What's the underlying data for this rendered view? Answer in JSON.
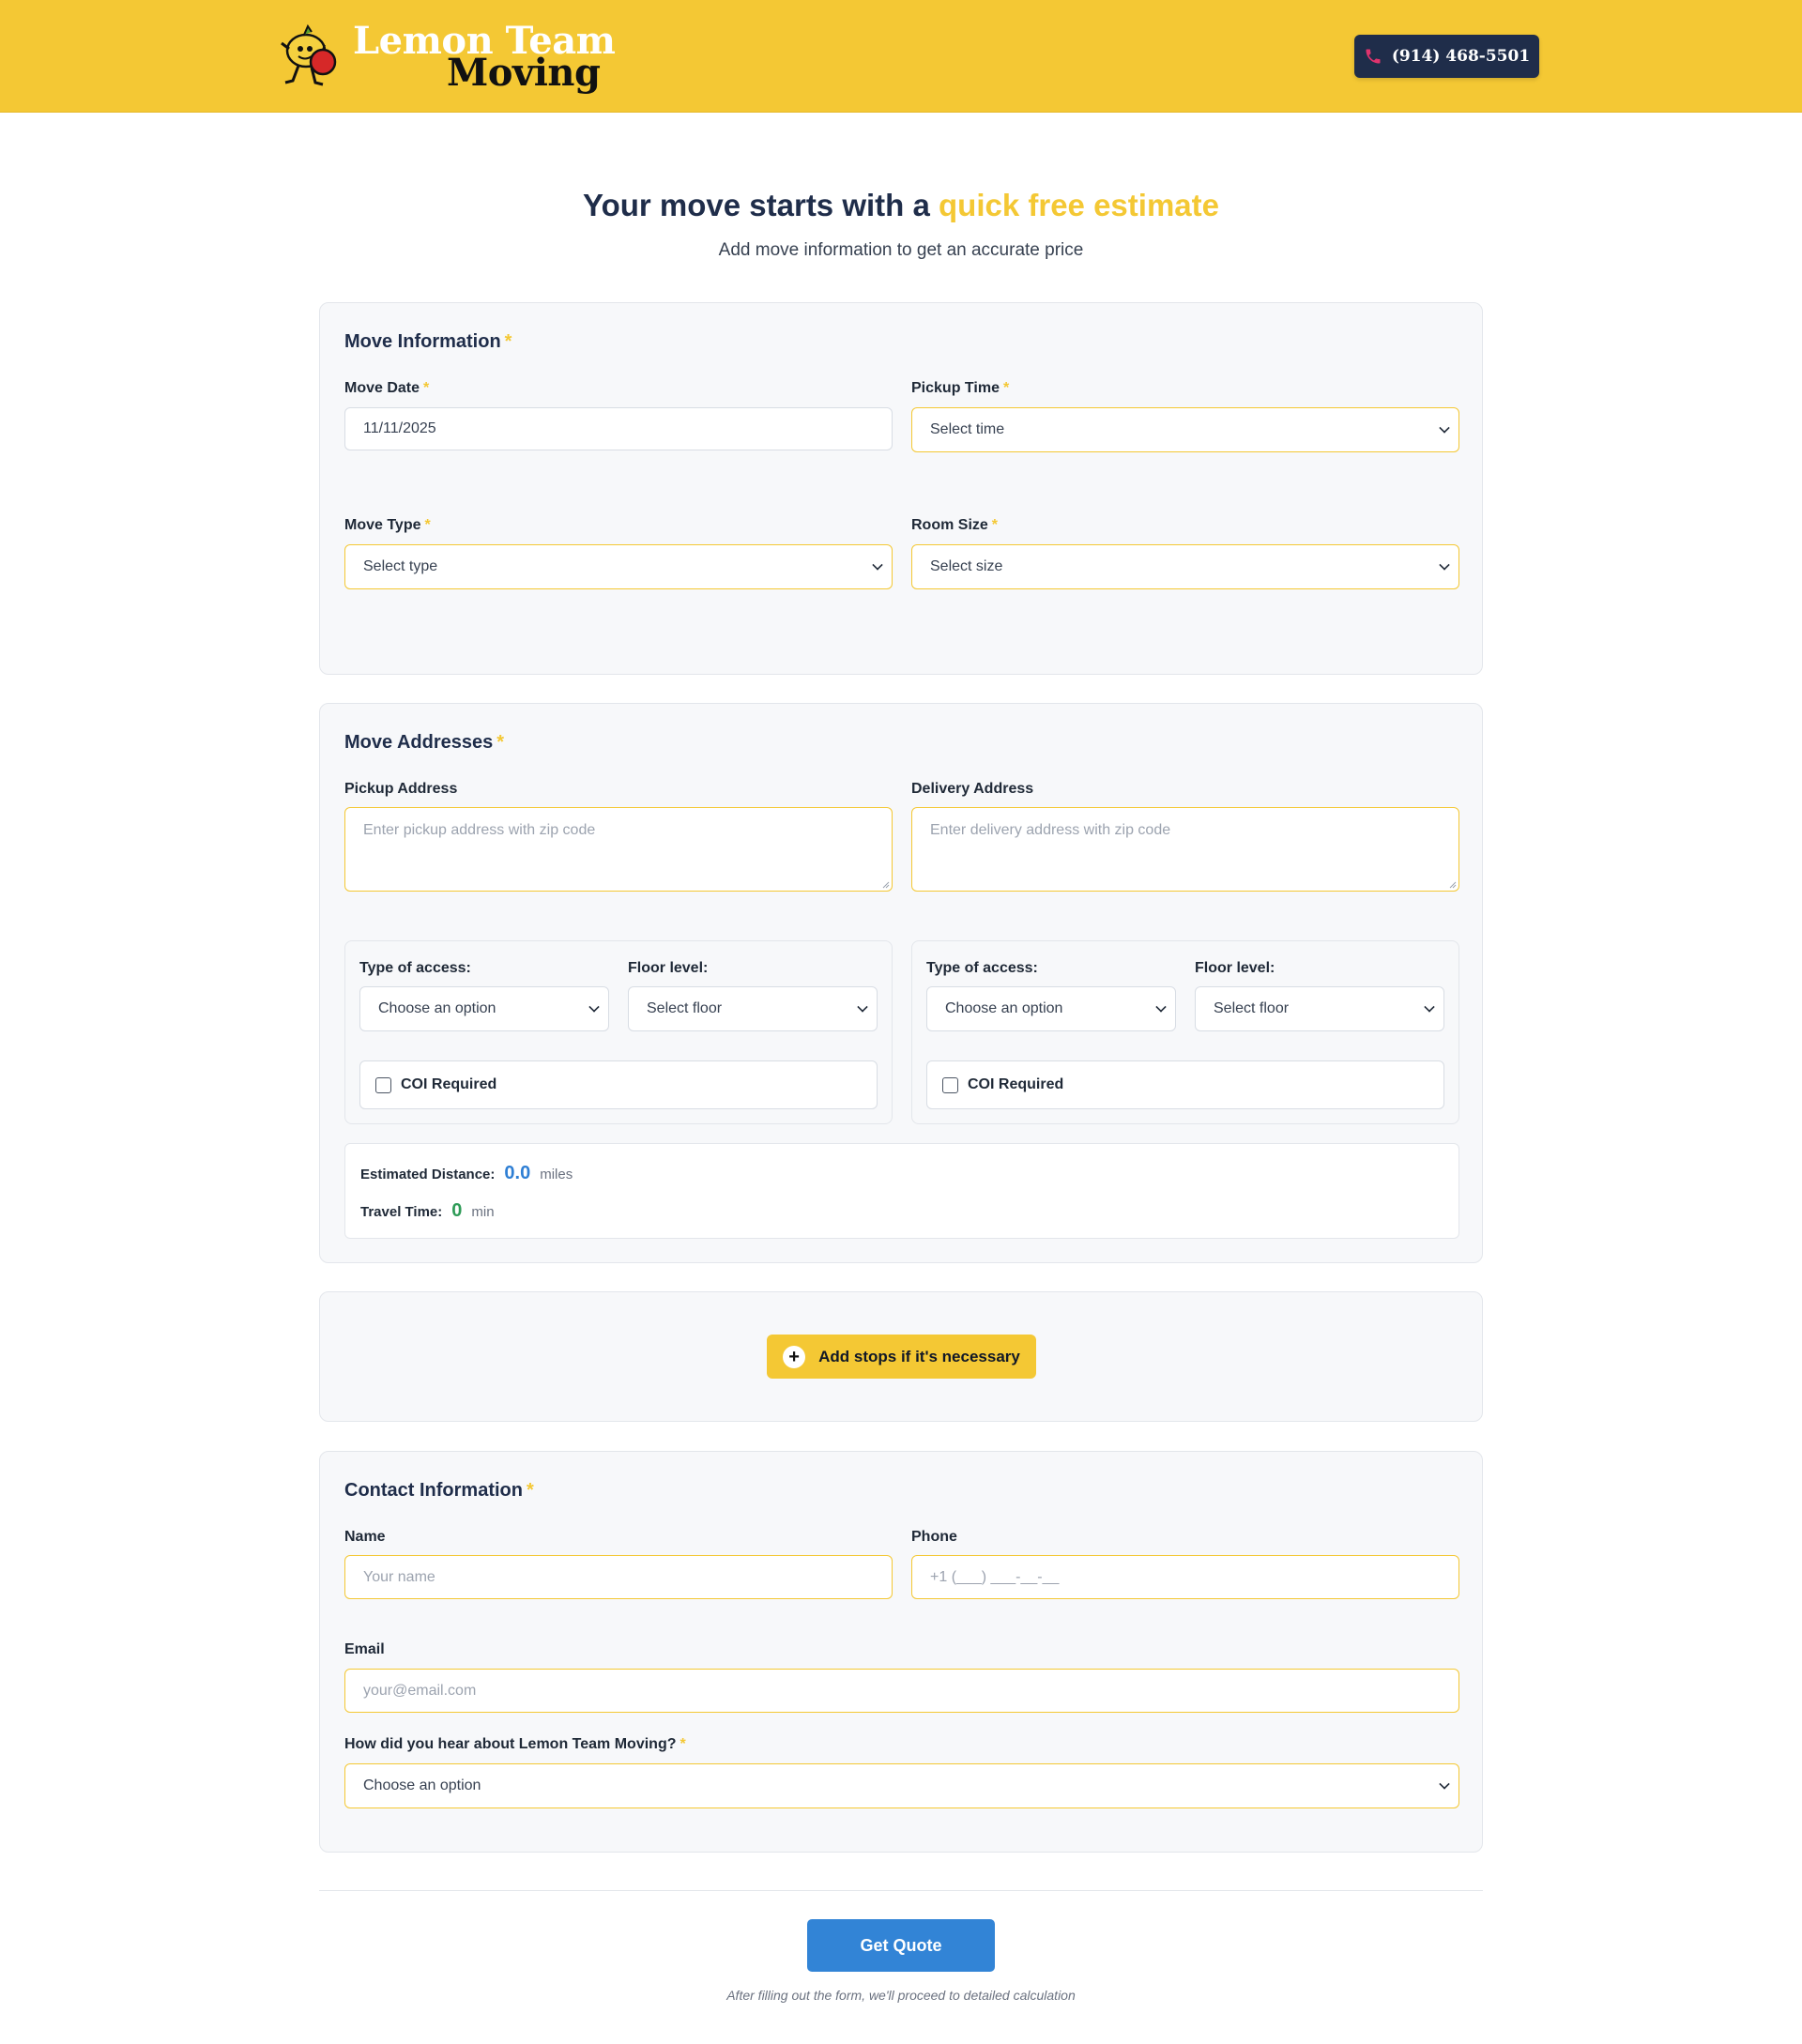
{
  "header": {
    "logo_line1": "Lemon Team",
    "logo_line2": "Moving",
    "phone": "(914) 468-5501",
    "colors": {
      "brand_yellow": "#f4c834",
      "navy": "#1f2d4a",
      "phone_icon": "#e0336d"
    }
  },
  "hero": {
    "title_prefix": "Your move starts with a",
    "title_accent": "quick free estimate",
    "subtitle": "Add move information to get an accurate price"
  },
  "move_info": {
    "title": "Move Information",
    "required_mark": "*",
    "move_date": {
      "label": "Move Date",
      "value": "11/11/2025"
    },
    "pickup_time": {
      "label": "Pickup Time",
      "selected": "Select time"
    },
    "move_type": {
      "label": "Move Type",
      "selected": "Select type"
    },
    "room_size": {
      "label": "Room Size",
      "selected": "Select size"
    }
  },
  "addresses": {
    "title": "Move Addresses",
    "pickup": {
      "label": "Pickup Address",
      "placeholder": "Enter pickup address with zip code"
    },
    "delivery": {
      "label": "Delivery Address",
      "placeholder": "Enter delivery address with zip code"
    },
    "pickup_details": {
      "access_label": "Type of access:",
      "access_selected": "Choose an option",
      "floor_label": "Floor level:",
      "floor_selected": "Select floor",
      "coi_label": "COI Required"
    },
    "delivery_details": {
      "access_label": "Type of access:",
      "access_selected": "Choose an option",
      "floor_label": "Floor level:",
      "floor_selected": "Select floor",
      "coi_label": "COI Required"
    },
    "estimate": {
      "distance_label": "Estimated Distance:",
      "distance_value": "0.0",
      "distance_unit": "miles",
      "time_label": "Travel Time:",
      "time_value": "0",
      "time_unit": "min",
      "colors": {
        "distance": "#2f7fd4",
        "time": "#2e9b57"
      }
    }
  },
  "stops": {
    "button_label": "Add stops if it's necessary",
    "icon": "plus-icon"
  },
  "contact": {
    "title": "Contact Information",
    "name": {
      "label": "Name",
      "placeholder": "Your name"
    },
    "phone": {
      "label": "Phone",
      "placeholder": "+1 (___) ___-__-__"
    },
    "email": {
      "label": "Email",
      "placeholder": "your@email.com"
    },
    "referral": {
      "label": "How did you hear about Lemon Team Moving?",
      "selected": "Choose an option"
    }
  },
  "submit": {
    "button_label": "Get Quote",
    "footnote": "After filling out the form, we'll proceed to detailed calculation",
    "color": "#3284d6"
  }
}
